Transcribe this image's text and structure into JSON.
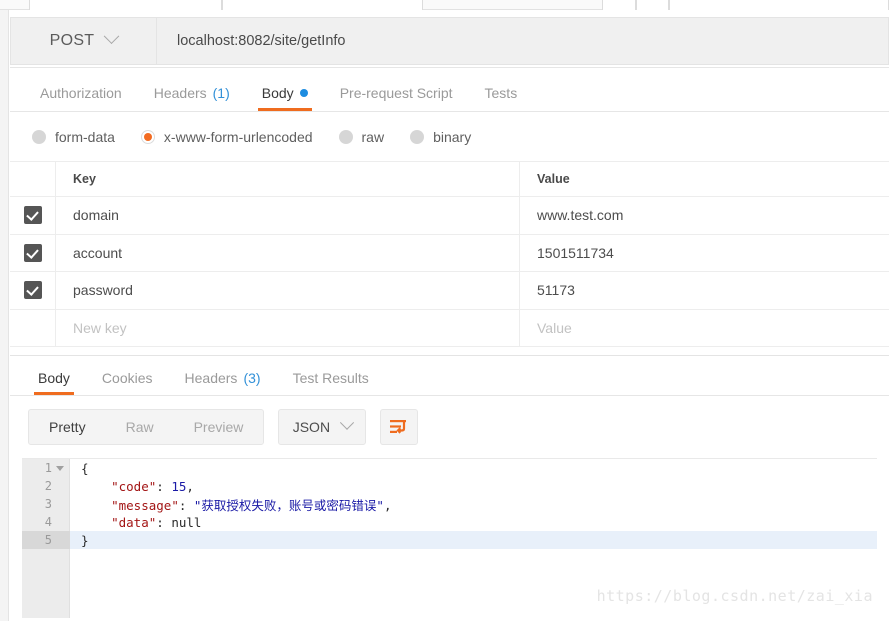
{
  "request": {
    "method": "POST",
    "url": "localhost:8082/site/getInfo",
    "tabs": [
      {
        "label": "Authorization",
        "count": null,
        "active": false,
        "dot": false
      },
      {
        "label": "Headers",
        "count": "(1)",
        "active": false,
        "dot": false
      },
      {
        "label": "Body",
        "count": null,
        "active": true,
        "dot": true
      },
      {
        "label": "Pre-request Script",
        "count": null,
        "active": false,
        "dot": false
      },
      {
        "label": "Tests",
        "count": null,
        "active": false,
        "dot": false
      }
    ],
    "body_types": [
      {
        "label": "form-data",
        "selected": false
      },
      {
        "label": "x-www-form-urlencoded",
        "selected": true
      },
      {
        "label": "raw",
        "selected": false
      },
      {
        "label": "binary",
        "selected": false
      }
    ],
    "table": {
      "headers": {
        "key": "Key",
        "value": "Value"
      },
      "rows": [
        {
          "checked": true,
          "key": "domain",
          "value": "www.test.com"
        },
        {
          "checked": true,
          "key": "account",
          "value": "1501511734"
        },
        {
          "checked": true,
          "key": "password",
          "value": "51173"
        }
      ],
      "new_row": {
        "key_placeholder": "New key",
        "value_placeholder": "Value"
      }
    }
  },
  "response": {
    "tabs": [
      {
        "label": "Body",
        "count": null,
        "active": true
      },
      {
        "label": "Cookies",
        "count": null,
        "active": false
      },
      {
        "label": "Headers",
        "count": "(3)",
        "active": false
      },
      {
        "label": "Test Results",
        "count": null,
        "active": false
      }
    ],
    "view_modes": [
      {
        "label": "Pretty",
        "active": true
      },
      {
        "label": "Raw",
        "active": false
      },
      {
        "label": "Preview",
        "active": false
      }
    ],
    "format": "JSON",
    "wrap_icon": "word-wrap-icon",
    "code": {
      "lines": [
        {
          "num": "1",
          "foldable": true,
          "active": false,
          "tokens": [
            {
              "t": "{",
              "c": "punct"
            }
          ]
        },
        {
          "num": "2",
          "foldable": false,
          "active": false,
          "tokens": [
            {
              "t": "    ",
              "c": "punct"
            },
            {
              "t": "\"code\"",
              "c": "key"
            },
            {
              "t": ": ",
              "c": "punct"
            },
            {
              "t": "15",
              "c": "num"
            },
            {
              "t": ",",
              "c": "punct"
            }
          ]
        },
        {
          "num": "3",
          "foldable": false,
          "active": false,
          "tokens": [
            {
              "t": "    ",
              "c": "punct"
            },
            {
              "t": "\"message\"",
              "c": "key"
            },
            {
              "t": ": ",
              "c": "punct"
            },
            {
              "t": "\"获取授权失败，账号或密码错误\"",
              "c": "str"
            },
            {
              "t": ",",
              "c": "punct"
            }
          ]
        },
        {
          "num": "4",
          "foldable": false,
          "active": false,
          "tokens": [
            {
              "t": "    ",
              "c": "punct"
            },
            {
              "t": "\"data\"",
              "c": "key"
            },
            {
              "t": ": ",
              "c": "punct"
            },
            {
              "t": "null",
              "c": "null"
            }
          ]
        },
        {
          "num": "5",
          "foldable": false,
          "active": true,
          "tokens": [
            {
              "t": "}",
              "c": "punct"
            }
          ]
        }
      ]
    }
  },
  "watermark": "https://blog.csdn.net/zai_xia",
  "colors": {
    "accent": "#ef6c1f",
    "link": "#3391d8",
    "dot": "#1d8ce0",
    "checkbox": "#555555",
    "active_line": "#e8f0fa"
  }
}
